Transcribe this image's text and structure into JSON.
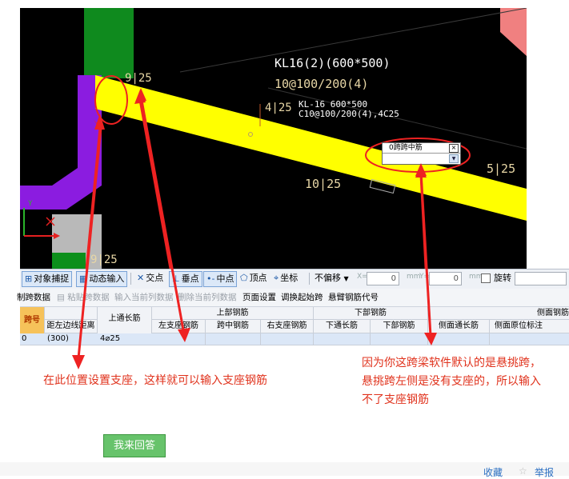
{
  "cad": {
    "beam_title": "KL16(2)(600*500)",
    "beam_stirrup": "10@100/200(4)",
    "label_left_top": "9|25",
    "label_left_mid": "4|25",
    "overlap_label_1": "KL-16 600*500",
    "overlap_label_2": "C10@100/200(4),4C25",
    "label_bottom_mid": "10|25",
    "label_right": "5|25",
    "label_bottom_left": "9|25",
    "axis_y": "Y",
    "popup": {
      "value": "0跨跨中筋",
      "close_icon": "close-icon",
      "dropdown_icon": "chevron-down-icon"
    },
    "colors": {
      "yellow": "#ffff00",
      "purple": "#8b1ce0",
      "green": "#0f8a1e",
      "gray": "#b9b9b9",
      "pink": "#f08080"
    }
  },
  "toolbar": {
    "snap": "对象捕捉",
    "dynamic_input": "动态输入",
    "intersection": "交点",
    "perpendicular": "垂点",
    "midpoint": "中点",
    "vertex": "顶点",
    "coordinate": "坐标",
    "offset_mode": "不偏移",
    "x_label": "X=",
    "x_value": "0",
    "x_unit": "mm",
    "y_label": "Y=",
    "y_value": "0",
    "y_unit": "mm",
    "rotate": "旋转"
  },
  "toolbar2": {
    "copy_span": "制跨数据",
    "paste_span": "粘贴跨数据",
    "input_col": "输入当前列数据",
    "delete_col": "删除当前列数据",
    "page_setup": "页面设置",
    "swap_start": "调换起始跨",
    "cantilever_code": "悬臂钢筋代号"
  },
  "table": {
    "col_span": "跨号",
    "col_distance": "距左边线距离",
    "col_top_through": "上通长筋",
    "group_top": "上部钢筋",
    "sub_left": "左支座钢筋",
    "sub_mid": "跨中钢筋",
    "sub_right": "右支座钢筋",
    "group_bottom": "下部钢筋",
    "sub_bottom_through": "下通长筋",
    "sub_bottom": "下部钢筋",
    "group_side": "侧面钢筋",
    "sub_side_through": "侧面通长筋",
    "sub_side_original": "侧面原位标注",
    "row": {
      "span": "0",
      "distance": "(300)",
      "top_through": "4⌀25"
    }
  },
  "annotations": {
    "left_note": "在此位置设置支座，这样就可以输入支座钢筋",
    "right_note_line1": "因为你这跨梁软件默认的是悬挑跨，",
    "right_note_line2": "悬挑跨左侧是没有支座的，所以输入",
    "right_note_line3": "不了支座钢筋"
  },
  "answer_button": "我来回答",
  "footer": {
    "collect": "收藏",
    "report": "举报"
  }
}
